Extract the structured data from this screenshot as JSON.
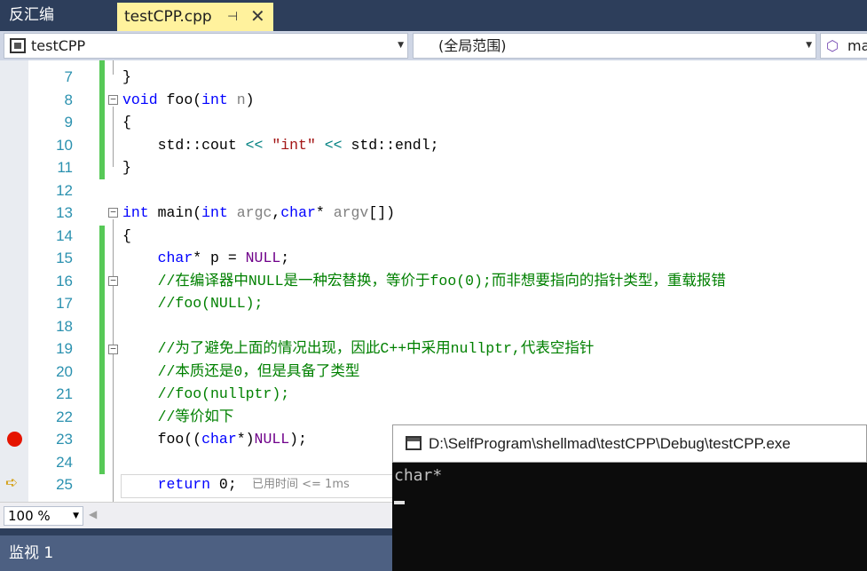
{
  "tabs": {
    "inactive_label": "反汇编",
    "active_label": "testCPP.cpp",
    "pin_glyph": "⊣",
    "close_glyph": "✕"
  },
  "navbar": {
    "project": "testCPP",
    "scope": "(全局范围)",
    "member": "ma"
  },
  "editor": {
    "line_numbers": [
      "7",
      "8",
      "9",
      "10",
      "11",
      "12",
      "13",
      "14",
      "15",
      "16",
      "17",
      "18",
      "19",
      "20",
      "21",
      "22",
      "23",
      "24",
      "25"
    ],
    "elapsed_hint": "已用时间 <= 1ms"
  },
  "zoom": {
    "value": "100 %"
  },
  "watch": {
    "title": "监视 1"
  },
  "console": {
    "title": "D:\\SelfProgram\\shellmad\\testCPP\\Debug\\testCPP.exe",
    "output": "char*"
  },
  "colors": {
    "tab_strip": "#2d3e5b",
    "active_tab": "#fff29d",
    "keyword": "#0000ff",
    "comment": "#008000",
    "string": "#a31515",
    "line_number": "#2b91af",
    "change_bar": "#57c957",
    "breakpoint": "#e51400"
  }
}
